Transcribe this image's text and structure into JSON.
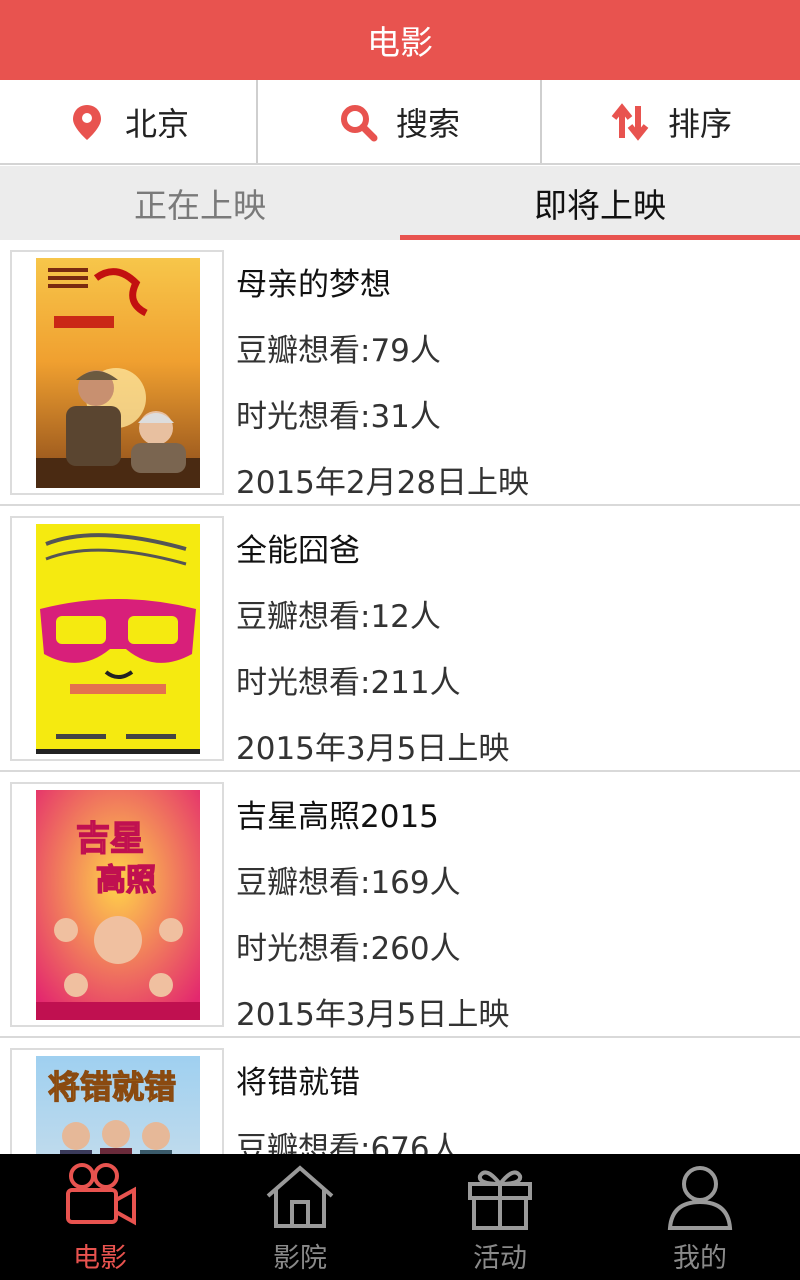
{
  "header": {
    "title": "电影"
  },
  "toolbar": {
    "location": "北京",
    "search": "搜索",
    "sort": "排序"
  },
  "tabs": {
    "now_showing": "正在上映",
    "coming_soon": "即将上映",
    "active": "coming_soon"
  },
  "movies": [
    {
      "title": "母亲的梦想",
      "douban": "豆瓣想看:79人",
      "mtime": "时光想看:31人",
      "release": "2015年2月28日上映",
      "poster_icon": "poster-mothers-dream"
    },
    {
      "title": "全能囧爸",
      "douban": "豆瓣想看:12人",
      "mtime": "时光想看:211人",
      "release": "2015年3月5日上映",
      "poster_icon": "poster-almighty-dad"
    },
    {
      "title": "吉星高照2015",
      "douban": "豆瓣想看:169人",
      "mtime": "时光想看:260人",
      "release": "2015年3月5日上映",
      "poster_icon": "poster-lucky-star"
    },
    {
      "title": "将错就错",
      "douban": "豆瓣想看:676人",
      "mtime": "",
      "release": "",
      "poster_icon": "poster-right-mistake"
    }
  ],
  "bottom_nav": [
    {
      "label": "电影",
      "icon": "movie-camera-icon",
      "active": true
    },
    {
      "label": "影院",
      "icon": "home-icon",
      "active": false
    },
    {
      "label": "活动",
      "icon": "gift-icon",
      "active": false
    },
    {
      "label": "我的",
      "icon": "user-icon",
      "active": false
    }
  ],
  "colors": {
    "accent": "#e8534f",
    "nav_bg": "#000000",
    "tab_bg": "#ececec"
  }
}
